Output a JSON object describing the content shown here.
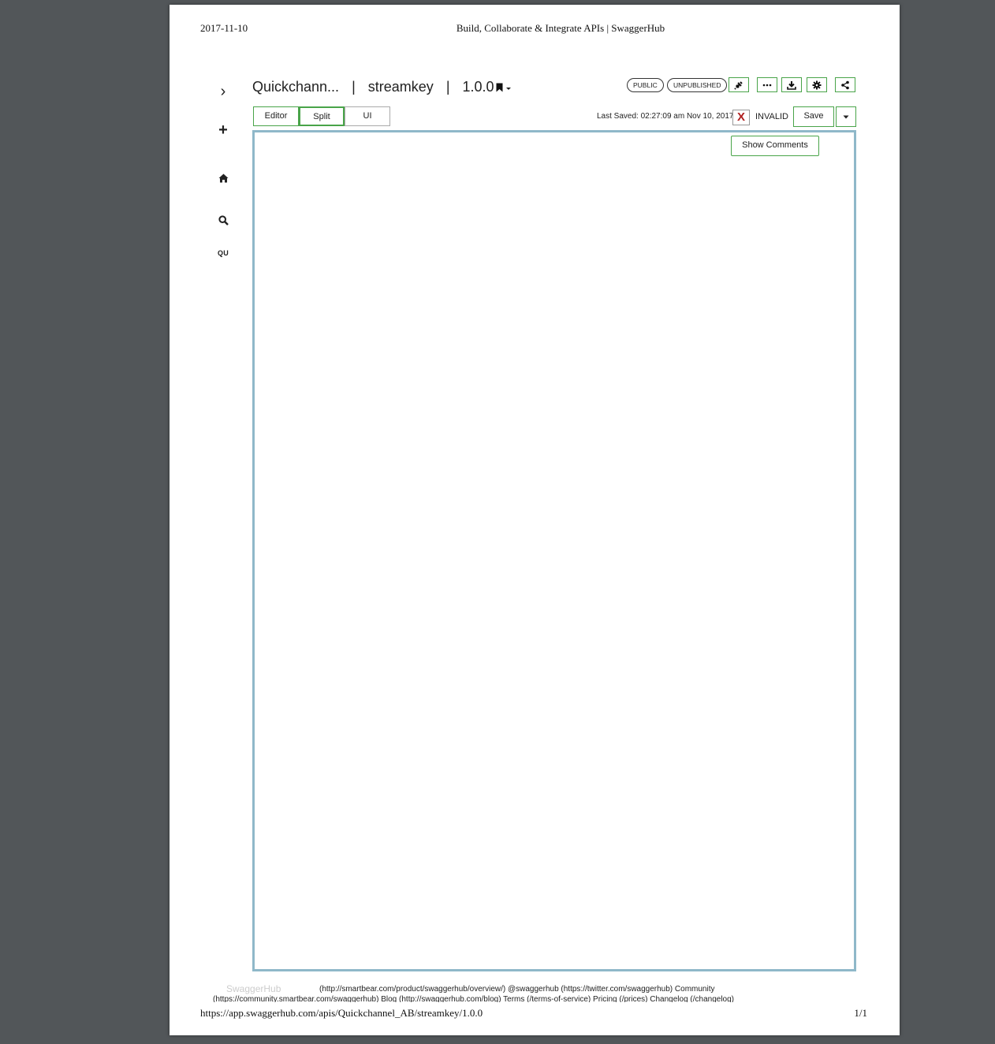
{
  "print": {
    "date": "2017-11-10",
    "title": "Build, Collaborate & Integrate APIs | SwaggerHub",
    "url": "https://app.swaggerhub.com/apis/Quickchannel_AB/streamkey/1.0.0",
    "pages": "1/1"
  },
  "nav": {
    "chevron": "›",
    "plus": "+",
    "user_initials": "QU"
  },
  "header": {
    "owner": "Quickchann...",
    "separator": "|",
    "api_name": "streamkey",
    "version": "1.0.0",
    "badges": {
      "public": "PUBLIC",
      "unpublished": "UNPUBLISHED"
    },
    "icons": [
      "plug-icon",
      "more-icon",
      "download-icon",
      "gear-icon",
      "share-icon"
    ]
  },
  "tabs": {
    "editor": "Editor",
    "split": "Split",
    "ui": "UI",
    "active": "Split"
  },
  "status": {
    "last_saved": "Last Saved: 02:27:09 am Nov 10, 2017",
    "invalid_mark": "X",
    "invalid_label": "INVALID",
    "save": "Save"
  },
  "panel": {
    "show_comments": "Show Comments"
  },
  "footer": {
    "ghost": "SwaggerHub",
    "line1": "(http://smartbear.com/product/swaggerhub/overview/)    @swaggerhub (https://twitter.com/swaggerhub)    Community",
    "line2": "(https://community.smartbear.com/swaggerhub)    Blog (http://swaggerhub.com/blog)    Terms (/terms-of-service)    Pricing (/prices)    Changelog (/changelog)"
  },
  "colors": {
    "accent": "#49a449",
    "panel_border": "#8fb8c9",
    "invalid": "#b02020",
    "viewer_bg": "#525659"
  }
}
